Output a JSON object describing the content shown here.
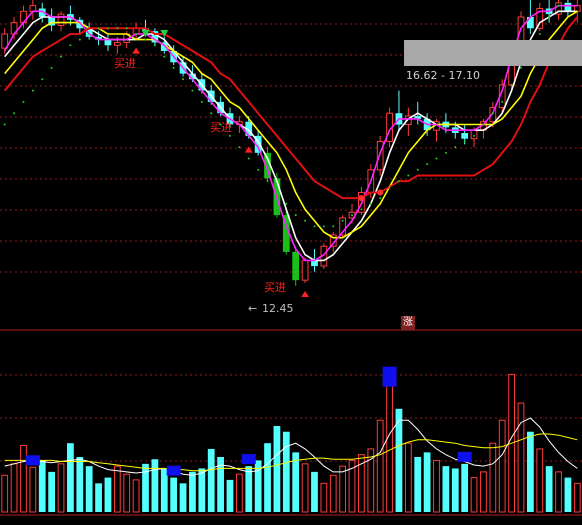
{
  "colors": {
    "background": "#000000",
    "up": "#ff3b3b",
    "down": "#54ffff",
    "down_big": "#18c018",
    "grid": "#8c1c1c",
    "ma_white": "#ffffff",
    "ma_yellow": "#ffff00",
    "ma_magenta": "#ff22ff",
    "ma_red": "#e01010",
    "dots": "#22cc22",
    "signal": "#ff2020",
    "low_label": "#c0c0c0",
    "tooltip_bg": "#a8a8a8",
    "marker": "#ff3030"
  },
  "labels": {
    "low_price": "12.45",
    "price_range": "16.62 - 17.10",
    "buy_signal": "买进",
    "zhang_badge": "涨"
  },
  "chart_data": [
    {
      "type": "candlestick",
      "title": "",
      "xlabel": "",
      "ylabel": "",
      "ylim": [
        12.2,
        17.5
      ],
      "grid": true,
      "annotations": [
        {
          "text": "12.45",
          "kind": "period-low",
          "bar": 30
        },
        {
          "text": "16.62 - 17.10",
          "kind": "price-range",
          "bar": 61
        },
        {
          "text": "买进",
          "kind": "buy-signal",
          "bar": 14
        },
        {
          "text": "买进",
          "kind": "buy-signal",
          "bar": 26
        },
        {
          "text": "买进",
          "kind": "buy-signal",
          "bar": 32
        }
      ],
      "ohlc": [
        [
          16.65,
          17.0,
          16.55,
          16.9
        ],
        [
          16.9,
          17.2,
          16.8,
          17.1
        ],
        [
          17.1,
          17.4,
          17.0,
          17.3
        ],
        [
          17.3,
          17.5,
          17.15,
          17.4
        ],
        [
          17.35,
          17.45,
          17.1,
          17.2
        ],
        [
          17.2,
          17.35,
          16.95,
          17.05
        ],
        [
          17.05,
          17.3,
          16.95,
          17.25
        ],
        [
          17.25,
          17.4,
          17.05,
          17.15
        ],
        [
          17.15,
          17.2,
          16.9,
          17.0
        ],
        [
          17.0,
          17.1,
          16.8,
          16.85
        ],
        [
          16.85,
          16.95,
          16.7,
          16.8
        ],
        [
          16.8,
          16.9,
          16.6,
          16.7
        ],
        [
          16.7,
          16.85,
          16.55,
          16.75
        ],
        [
          16.75,
          16.95,
          16.65,
          16.9
        ],
        [
          16.9,
          17.1,
          16.8,
          17.0
        ],
        [
          17.0,
          17.15,
          16.85,
          16.95
        ],
        [
          16.95,
          17.0,
          16.7,
          16.75
        ],
        [
          16.75,
          16.85,
          16.55,
          16.6
        ],
        [
          16.6,
          16.7,
          16.35,
          16.4
        ],
        [
          16.4,
          16.5,
          16.15,
          16.2
        ],
        [
          16.2,
          16.35,
          16.05,
          16.1
        ],
        [
          16.1,
          16.2,
          15.85,
          15.9
        ],
        [
          15.9,
          16.0,
          15.65,
          15.7
        ],
        [
          15.7,
          15.8,
          15.45,
          15.5
        ],
        [
          15.5,
          15.6,
          15.25,
          15.3
        ],
        [
          15.3,
          15.45,
          15.15,
          15.35
        ],
        [
          15.35,
          15.45,
          15.05,
          15.1
        ],
        [
          15.1,
          15.2,
          14.75,
          14.8
        ],
        [
          14.8,
          14.9,
          14.3,
          14.35
        ],
        [
          14.35,
          14.45,
          13.65,
          13.7
        ],
        [
          13.7,
          13.8,
          13.0,
          13.05
        ],
        [
          13.05,
          13.15,
          12.45,
          12.55
        ],
        [
          12.55,
          12.95,
          12.5,
          12.9
        ],
        [
          12.9,
          13.1,
          12.7,
          12.8
        ],
        [
          12.8,
          13.2,
          12.75,
          13.15
        ],
        [
          13.15,
          13.4,
          13.05,
          13.35
        ],
        [
          13.35,
          13.7,
          13.3,
          13.65
        ],
        [
          13.65,
          13.9,
          13.55,
          13.75
        ],
        [
          13.75,
          14.2,
          13.7,
          14.1
        ],
        [
          14.1,
          14.6,
          14.0,
          14.5
        ],
        [
          14.5,
          15.1,
          14.4,
          15.0
        ],
        [
          15.0,
          15.6,
          14.9,
          15.5
        ],
        [
          15.5,
          15.9,
          15.2,
          15.3
        ],
        [
          15.3,
          15.6,
          15.1,
          15.45
        ],
        [
          15.45,
          15.7,
          15.3,
          15.4
        ],
        [
          15.4,
          15.5,
          15.1,
          15.2
        ],
        [
          15.2,
          15.4,
          15.0,
          15.35
        ],
        [
          15.35,
          15.5,
          15.15,
          15.25
        ],
        [
          15.25,
          15.35,
          15.05,
          15.15
        ],
        [
          15.15,
          15.3,
          14.95,
          15.05
        ],
        [
          15.05,
          15.25,
          14.9,
          15.2
        ],
        [
          15.2,
          15.4,
          15.05,
          15.35
        ],
        [
          15.35,
          15.7,
          15.25,
          15.6
        ],
        [
          15.6,
          16.1,
          15.5,
          16.0
        ],
        [
          16.0,
          16.7,
          15.9,
          16.6
        ],
        [
          16.6,
          17.3,
          16.5,
          17.2
        ],
        [
          17.2,
          17.5,
          16.9,
          17.0
        ],
        [
          17.0,
          17.45,
          16.95,
          17.35
        ],
        [
          17.35,
          17.5,
          17.1,
          17.25
        ],
        [
          17.25,
          17.5,
          17.15,
          17.45
        ],
        [
          17.45,
          17.55,
          17.2,
          17.3
        ],
        [
          17.3,
          17.5,
          17.1,
          17.4
        ]
      ],
      "ma_series": [
        {
          "color_key": "ma_white",
          "values": [
            16.5,
            16.7,
            16.9,
            17.1,
            17.2,
            17.2,
            17.2,
            17.2,
            17.1,
            17.0,
            16.9,
            16.8,
            16.8,
            16.8,
            16.8,
            16.9,
            16.9,
            16.8,
            16.6,
            16.4,
            16.2,
            16.0,
            15.8,
            15.6,
            15.4,
            15.3,
            15.2,
            15.0,
            14.7,
            14.3,
            13.8,
            13.3,
            13.0,
            12.9,
            12.9,
            13.0,
            13.2,
            13.4,
            13.6,
            13.9,
            14.3,
            14.8,
            15.2,
            15.4,
            15.5,
            15.4,
            15.3,
            15.3,
            15.3,
            15.2,
            15.2,
            15.2,
            15.3,
            15.5,
            15.9,
            16.4,
            16.8,
            17.1,
            17.2,
            17.3,
            17.3,
            17.3
          ]
        },
        {
          "color_key": "ma_yellow",
          "values": [
            16.2,
            16.4,
            16.6,
            16.8,
            17.0,
            17.1,
            17.1,
            17.1,
            17.1,
            17.0,
            17.0,
            16.9,
            16.9,
            16.9,
            16.8,
            16.8,
            16.8,
            16.7,
            16.6,
            16.5,
            16.4,
            16.2,
            16.1,
            15.9,
            15.7,
            15.6,
            15.4,
            15.2,
            15.0,
            14.8,
            14.5,
            14.1,
            13.8,
            13.6,
            13.4,
            13.3,
            13.3,
            13.4,
            13.5,
            13.7,
            13.9,
            14.2,
            14.5,
            14.8,
            15.0,
            15.2,
            15.3,
            15.3,
            15.3,
            15.3,
            15.3,
            15.3,
            15.3,
            15.4,
            15.6,
            15.8,
            16.2,
            16.5,
            16.8,
            17.0,
            17.2,
            17.3
          ]
        },
        {
          "color_key": "ma_magenta",
          "values": [
            16.6,
            16.9,
            17.1,
            17.3,
            17.3,
            17.2,
            17.2,
            17.2,
            17.1,
            16.9,
            16.8,
            16.8,
            16.8,
            16.8,
            16.9,
            16.9,
            16.8,
            16.7,
            16.5,
            16.3,
            16.1,
            15.9,
            15.7,
            15.5,
            15.4,
            15.3,
            15.1,
            14.9,
            14.5,
            14.0,
            13.5,
            13.1,
            12.9,
            12.9,
            13.0,
            13.2,
            13.4,
            13.6,
            13.9,
            14.3,
            14.8,
            15.2,
            15.4,
            15.4,
            15.4,
            15.3,
            15.3,
            15.2,
            15.2,
            15.2,
            15.2,
            15.3,
            15.5,
            15.9,
            16.5,
            17.0,
            17.2,
            17.3,
            17.3,
            17.4,
            17.4,
            17.4
          ]
        },
        {
          "color_key": "ma_red",
          "values": [
            15.9,
            16.1,
            16.3,
            16.5,
            16.6,
            16.7,
            16.8,
            16.9,
            16.9,
            17.0,
            17.0,
            17.0,
            17.0,
            17.0,
            17.0,
            17.0,
            16.9,
            16.9,
            16.8,
            16.7,
            16.6,
            16.5,
            16.4,
            16.2,
            16.1,
            15.9,
            15.7,
            15.5,
            15.3,
            15.1,
            14.9,
            14.7,
            14.5,
            14.3,
            14.2,
            14.1,
            14.0,
            14.0,
            14.0,
            14.1,
            14.1,
            14.2,
            14.3,
            14.3,
            14.4,
            14.4,
            14.4,
            14.4,
            14.4,
            14.4,
            14.4,
            14.5,
            14.6,
            14.8,
            15.0,
            15.3,
            15.7,
            16.0,
            16.4,
            16.7,
            17.0,
            17.2
          ]
        },
        {
          "color_key": "dots",
          "dotted": true,
          "values": [
            15.3,
            15.5,
            15.7,
            15.9,
            16.1,
            16.3,
            16.5,
            16.7,
            16.8,
            16.9,
            17.0,
            17.0,
            17.0,
            17.0,
            16.9,
            16.8,
            16.7,
            16.5,
            16.3,
            16.1,
            15.9,
            15.7,
            15.5,
            15.3,
            15.1,
            14.9,
            14.7,
            14.5,
            14.3,
            14.1,
            13.9,
            13.7,
            13.6,
            13.5,
            13.5,
            13.5,
            13.6,
            13.7,
            13.8,
            13.9,
            14.0,
            14.2,
            14.3,
            14.4,
            14.5,
            14.6,
            14.7,
            14.8,
            14.9,
            15.0,
            15.1,
            15.3,
            15.5,
            15.7,
            16.0,
            16.3,
            16.6,
            16.9,
            17.2,
            17.4,
            17.6,
            17.8
          ]
        }
      ]
    },
    {
      "type": "bar",
      "title": "",
      "xlabel": "",
      "ylabel": "",
      "ylim": [
        0,
        150
      ],
      "volume": [
        32,
        42,
        58,
        39,
        45,
        35,
        42,
        60,
        48,
        40,
        25,
        30,
        40,
        33,
        28,
        42,
        46,
        38,
        30,
        25,
        35,
        38,
        55,
        48,
        28,
        33,
        40,
        45,
        60,
        75,
        70,
        52,
        42,
        35,
        25,
        32,
        40,
        45,
        50,
        55,
        80,
        125,
        90,
        60,
        48,
        52,
        45,
        40,
        38,
        42,
        30,
        35,
        60,
        80,
        120,
        95,
        70,
        55,
        40,
        35,
        30,
        25
      ],
      "volume_lines": [
        {
          "color_key": "ma_white",
          "values": [
            40,
            42,
            44,
            45,
            44,
            43,
            44,
            45,
            46,
            44,
            40,
            37,
            36,
            35,
            34,
            35,
            37,
            38,
            36,
            33,
            32,
            34,
            38,
            41,
            40,
            37,
            35,
            36,
            42,
            50,
            57,
            60,
            55,
            48,
            40,
            35,
            35,
            38,
            42,
            46,
            52,
            68,
            80,
            80,
            72,
            62,
            55,
            50,
            46,
            44,
            41,
            40,
            42,
            50,
            65,
            78,
            82,
            74,
            62,
            52,
            44,
            38
          ]
        },
        {
          "color_key": "ma_yellow",
          "values": [
            45,
            45,
            45,
            45,
            45,
            45,
            44,
            44,
            44,
            44,
            43,
            42,
            41,
            40,
            39,
            38,
            38,
            38,
            37,
            37,
            36,
            36,
            37,
            38,
            38,
            38,
            38,
            38,
            39,
            41,
            43,
            45,
            46,
            47,
            47,
            46,
            46,
            46,
            47,
            48,
            50,
            54,
            58,
            61,
            63,
            63,
            62,
            61,
            60,
            58,
            57,
            56,
            56,
            57,
            60,
            63,
            66,
            68,
            68,
            67,
            65,
            63
          ]
        }
      ]
    }
  ]
}
